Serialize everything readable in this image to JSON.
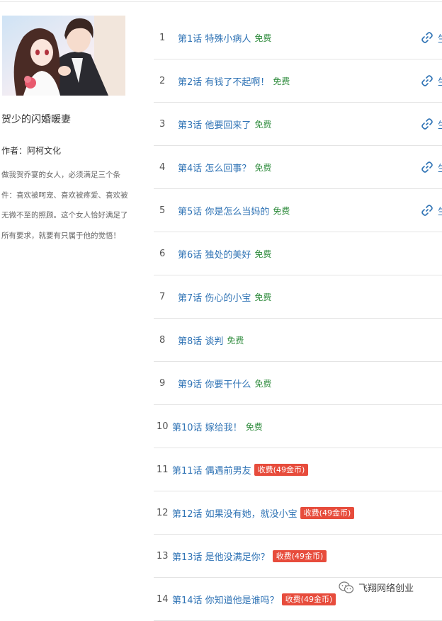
{
  "book": {
    "title": "贺少的闪婚暖妻",
    "author": "作者：阿柯文化",
    "description": "做我贺乔宴的女人，必须满足三个条件：喜欢被呵宠、喜欢被疼爱、喜欢被无微不至的照顾。这个女人恰好满足了所有要求，就要有只属于他的觉悟！"
  },
  "chapters": [
    {
      "num": "1",
      "title": "第1话 特殊小病人",
      "price": "免费",
      "paid": false,
      "link": true,
      "link_text": "生"
    },
    {
      "num": "2",
      "title": "第2话 有钱了不起啊！",
      "price": "免费",
      "paid": false,
      "link": true,
      "link_text": "生"
    },
    {
      "num": "3",
      "title": "第3话 他要回来了",
      "price": "免费",
      "paid": false,
      "link": true,
      "link_text": "生"
    },
    {
      "num": "4",
      "title": "第4话 怎么回事？",
      "price": "免费",
      "paid": false,
      "link": true,
      "link_text": "生"
    },
    {
      "num": "5",
      "title": "第5话 你是怎么当妈的",
      "price": "免费",
      "paid": false,
      "link": true,
      "link_text": "生"
    },
    {
      "num": "6",
      "title": "第6话 独处的美好",
      "price": "免费",
      "paid": false,
      "link": false
    },
    {
      "num": "7",
      "title": "第7话 伤心的小宝",
      "price": "免费",
      "paid": false,
      "link": false
    },
    {
      "num": "8",
      "title": "第8话 谈判",
      "price": "免费",
      "paid": false,
      "link": false
    },
    {
      "num": "9",
      "title": "第9话 你要干什么",
      "price": "免费",
      "paid": false,
      "link": false
    },
    {
      "num": "10",
      "title": "第10话 嫁给我！",
      "price": "免费",
      "paid": false,
      "link": false
    },
    {
      "num": "11",
      "title": "第11话 偶遇前男友",
      "price": "收费(49金币)",
      "paid": true,
      "link": false
    },
    {
      "num": "12",
      "title": "第12话 如果没有她，就没小宝",
      "price": "收费(49金币)",
      "paid": true,
      "link": false
    },
    {
      "num": "13",
      "title": "第13话 是他没满足你？",
      "price": "收费(49金币)",
      "paid": true,
      "link": false
    },
    {
      "num": "14",
      "title": "第14话 你知道他是谁吗？",
      "price": "收费(49金币)",
      "paid": true,
      "link": false
    }
  ],
  "watermark": "飞翔网络创业",
  "colors": {
    "link": "#2f73b5",
    "free": "#2e8b3c",
    "paid_badge": "#e74c3c"
  }
}
